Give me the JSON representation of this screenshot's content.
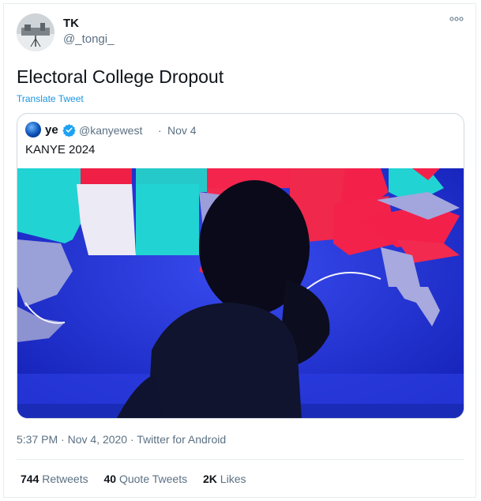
{
  "author": {
    "name": "TK",
    "handle": "@_tongi_"
  },
  "tweet": {
    "text": "Electoral College Dropout",
    "translate_label": "Translate Tweet"
  },
  "quoted": {
    "name": "ye",
    "handle": "@kanyewest",
    "separator": "·",
    "date": "Nov 4",
    "text": "KANYE 2024"
  },
  "meta": {
    "time": "5:37 PM",
    "separator1": "·",
    "date": "Nov 4, 2020",
    "separator2": "·",
    "source": "Twitter for Android"
  },
  "stats": {
    "retweets_count": "744",
    "retweets_label": "Retweets",
    "quotes_count": "40",
    "quotes_label": "Quote Tweets",
    "likes_count": "2K",
    "likes_label": "Likes"
  },
  "colors": {
    "link": "#1b95e0",
    "muted": "#5b7083",
    "border": "#e6ecf0",
    "verified": "#1da1f2"
  }
}
